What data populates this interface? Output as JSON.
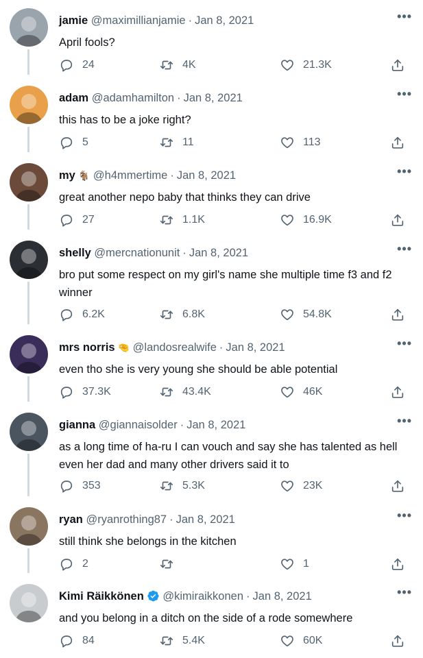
{
  "tweets": [
    {
      "name": "jamie",
      "handle": "@maximillianjamie",
      "date": "Jan 8, 2021",
      "text": "April fools?",
      "replies": "24",
      "retweets": "4K",
      "likes": "21.3K",
      "avatar_color": "#9aa4ad"
    },
    {
      "name": "adam",
      "handle": "@adamhamilton",
      "date": "Jan 8, 2021",
      "text": "this has to be a joke right?",
      "replies": "5",
      "retweets": "11",
      "likes": "113",
      "avatar_color": "#e8a04a"
    },
    {
      "name": "my",
      "name_emoji": "🐐",
      "handle": "@h4mmertime",
      "date": "Jan 8, 2021",
      "text": "great another nepo baby that thinks they can drive",
      "replies": "27",
      "retweets": "1.1K",
      "likes": "16.9K",
      "avatar_color": "#6b4a3a"
    },
    {
      "name": "shelly",
      "handle": "@mercnationunit",
      "date": "Jan 8, 2021",
      "text": "bro put some respect on my girl's name she multiple time f3 and f2 winner",
      "replies": "6.2K",
      "retweets": "6.8K",
      "likes": "54.8K",
      "avatar_color": "#2b2f33"
    },
    {
      "name": "mrs norris",
      "name_emoji": "🤏",
      "handle": "@landosrealwife",
      "date": "Jan 8, 2021",
      "text": "even tho she is very young she should be able potential",
      "replies": "37.3K",
      "retweets": "43.4K",
      "likes": "46K",
      "avatar_color": "#3b2d5a"
    },
    {
      "name": "gianna",
      "handle": "@giannaisolder",
      "date": "Jan 8, 2021",
      "text": "as a long time of ha-ru I can vouch and say she has talented as hell even her dad and many other drivers said it to",
      "replies": "353",
      "retweets": "5.3K",
      "likes": "23K",
      "avatar_color": "#4a5560"
    },
    {
      "name": "ryan",
      "handle": "@ryanrothing87",
      "date": "Jan 8, 2021",
      "text": "still think she belongs in the kitchen",
      "replies": "2",
      "retweets": "",
      "likes": "1",
      "avatar_color": "#8a7560"
    },
    {
      "name": "Kimi Räikkönen",
      "verified": true,
      "handle": "@kimiraikkonen",
      "date": "Jan 8, 2021",
      "text": "and you belong in a ditch on the side of a rode somewhere",
      "replies": "84",
      "retweets": "5.4K",
      "likes": "60K",
      "avatar_color": "#c9cccf"
    }
  ],
  "more_label": "•••",
  "separator": "·",
  "colors": {
    "secondary_text": "#536471",
    "thread_line": "#cfd9de",
    "verified_blue": "#1d9bf0"
  }
}
